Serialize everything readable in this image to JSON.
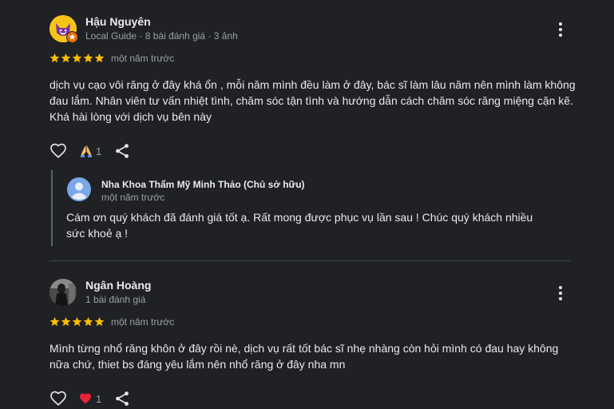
{
  "reviews": [
    {
      "name": "Hậu Nguyên",
      "meta": "Local Guide · 8 bài đánh giá · 3 ảnh",
      "rating": 5,
      "time": "một năm trước",
      "text": "dịch vụ cạo vôi răng ở đây khá ổn , mỗi năm mình đều làm ở đây, bác sĩ làm lâu năm nên mình làm không đau lắm. Nhân viên tư vấn nhiệt tình, chăm sóc tận tình và hướng dẫn cách chăm sóc răng miệng cặn kẽ. Khá hài lòng với dịch vụ bên này",
      "reaction_count": "1",
      "owner_response": {
        "name": "Nha Khoa Thẩm Mỹ Minh Thảo (Chủ sở hữu)",
        "time": "một năm trước",
        "text": "Cám ơn quý khách đã đánh giá tốt ạ. Rất mong được phục vụ lần sau ! Chúc quý khách nhiều sức khoẻ ạ !"
      }
    },
    {
      "name": "Ngân Hoàng",
      "meta": "1 bài đánh giá",
      "rating": 5,
      "time": "một năm trước",
      "text": "Mình từng nhổ răng khôn ở đây rồi nè, dịch vụ rất tốt bác sĩ nhẹ nhàng còn hỏi mình có đau hay không nữa chứ, thiet bs đáng yêu lắm nên nhổ răng ở đây nha mn",
      "reaction_count": "1"
    }
  ],
  "colors": {
    "background": "#202124",
    "text": "#e8eaed",
    "muted": "#9aa0a6",
    "star": "#fbbc04",
    "heart": "#e8233b",
    "badge": "#e8710a"
  },
  "icons": {
    "like": "heart-outline-icon",
    "share": "share-icon",
    "more": "more-vert-icon",
    "reaction_1": "folded-hands-emoji",
    "reaction_2": "red-heart-emoji"
  }
}
